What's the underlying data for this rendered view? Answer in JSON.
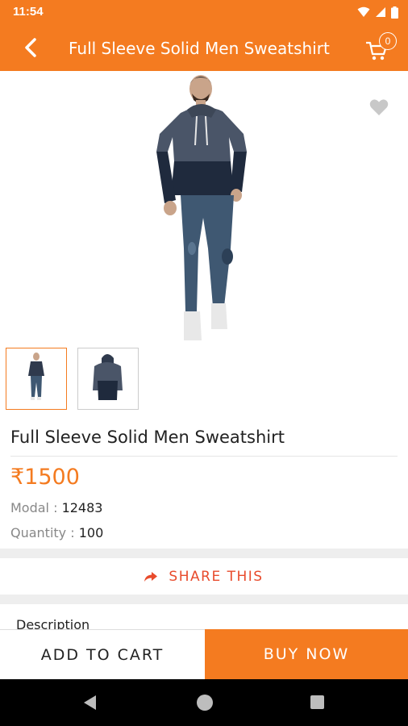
{
  "status_bar": {
    "time": "11:54"
  },
  "app_bar": {
    "title": "Full Sleeve Solid Men Sweatshirt",
    "cart_count": "0"
  },
  "product": {
    "name": "Full Sleeve Solid Men Sweatshirt",
    "price": "₹1500",
    "model_label": "Modal : ",
    "model_value": "12483",
    "quantity_label": "Quantity : ",
    "quantity_value": "100",
    "wishlisted": false
  },
  "gallery": {
    "thumbnails": [
      "front-view",
      "back-view"
    ],
    "selected_index": 0
  },
  "share": {
    "label": "SHARE THIS"
  },
  "description": {
    "heading": "Description"
  },
  "actions": {
    "add_to_cart": "ADD TO CART",
    "buy_now": "BUY NOW"
  },
  "colors": {
    "accent": "#f47b20",
    "share": "#e84b2c",
    "sweatshirt_top": "#4a5568",
    "sweatshirt_bottom": "#1f2a3d",
    "jeans": "#3f5872"
  },
  "icons": {
    "back": "arrow-left-icon",
    "cart": "cart-icon",
    "wishlist": "heart-icon",
    "share": "share-arrow-icon",
    "wifi": "wifi-icon",
    "signal": "signal-icon",
    "battery": "battery-icon"
  }
}
